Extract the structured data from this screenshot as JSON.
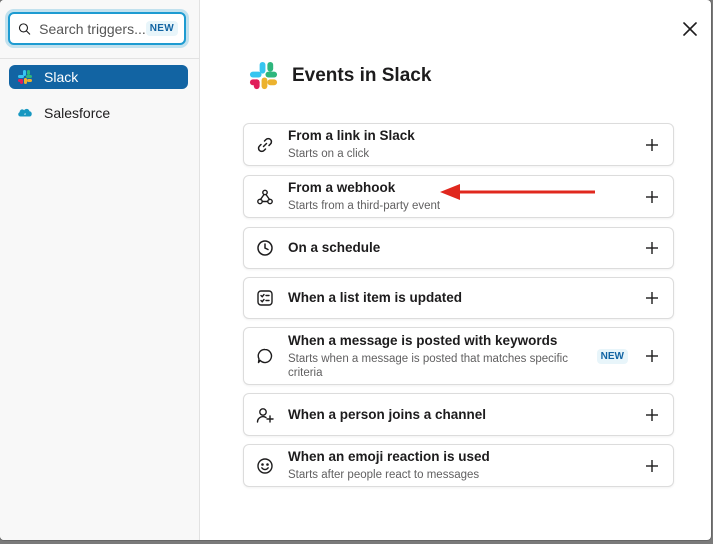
{
  "search": {
    "placeholder": "Search triggers...",
    "badge": "NEW"
  },
  "sidebar": {
    "items": [
      {
        "label": "Slack",
        "icon": "slack-logo-icon",
        "active": true
      },
      {
        "label": "Salesforce",
        "icon": "salesforce-logo-icon",
        "active": false
      }
    ]
  },
  "main": {
    "title": "Events in Slack",
    "triggers": [
      {
        "title": "From a link in Slack",
        "subtitle": "Starts on a click",
        "icon": "link-icon"
      },
      {
        "title": "From a webhook",
        "subtitle": "Starts from a third-party event",
        "icon": "webhook-icon"
      },
      {
        "title": "On a schedule",
        "subtitle": "",
        "icon": "clock-icon"
      },
      {
        "title": "When a list item is updated",
        "subtitle": "",
        "icon": "list-icon"
      },
      {
        "title": "When a message is posted with keywords",
        "subtitle": "Starts when a message is posted that matches specific criteria",
        "icon": "message-icon",
        "badge": "NEW"
      },
      {
        "title": "When a person joins a channel",
        "subtitle": "",
        "icon": "person-add-icon"
      },
      {
        "title": "When an emoji reaction is used",
        "subtitle": "Starts after people react to messages",
        "icon": "emoji-icon"
      }
    ]
  },
  "colors": {
    "accent": "#1264a3",
    "focus": "#1d9bd1",
    "annotation_arrow": "#e0281e"
  }
}
